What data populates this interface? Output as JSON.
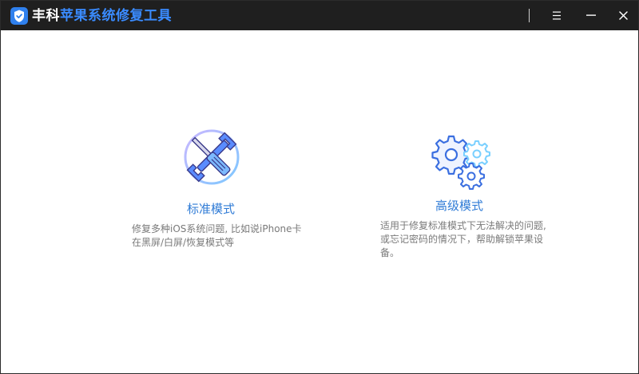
{
  "app": {
    "title_brand": "丰科",
    "title_product": "苹果系统修复工具",
    "logo_icon": "shield-check-icon",
    "titlebar_color": "#1f1f1f",
    "accent_color": "#3a8bff"
  },
  "window_controls": {
    "menu_symbol": "☰",
    "minimize_symbol": "—",
    "close_symbol": "✕"
  },
  "modes": [
    {
      "icon": "wrench-screwdriver-icon",
      "title": "标准模式",
      "description": "修复多种iOS系统问题, 比如说iPhone卡在黑屏/白屏/恢复模式等"
    },
    {
      "icon": "gears-icon",
      "title": "高级模式",
      "description": "适用于修复标准模式下无法解决的问题, 或忘记密码的情况下，帮助解锁苹果设备。"
    }
  ]
}
